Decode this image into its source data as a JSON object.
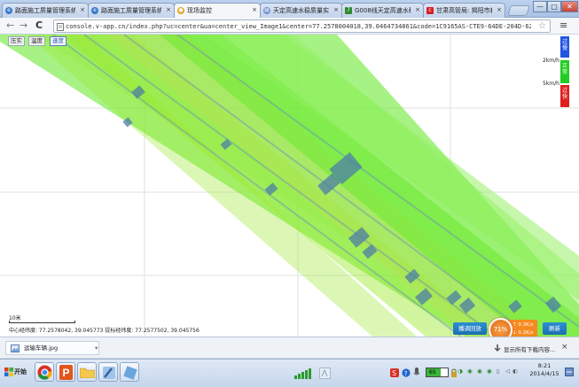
{
  "browser": {
    "tabs": [
      {
        "label": "路面施工质量管理系统",
        "icon_color": "#3a78c8",
        "active": false
      },
      {
        "label": "路面施工质量管理系统",
        "icon_color": "#3a78c8",
        "active": false
      },
      {
        "label": "现场监控",
        "icon_color": "#e8a11a",
        "active": true
      },
      {
        "label": "天定高速水稳质量实施工",
        "icon_color": "#6a8fc7",
        "active": false
      },
      {
        "label": "G008线天定高速水稳质量",
        "icon_color": "#2f8a2f",
        "active": false
      },
      {
        "label": "甘肃高管局: 揭阳市和丰",
        "icon_color": "#d42121",
        "active": false
      }
    ],
    "tab_close": "×",
    "window": {
      "minimize": "—",
      "maximize": "▢",
      "close": "✕"
    },
    "url": "console.v-app.cn/index.php?uc=center&ua=center_view_Image1&center=77.2578004018,39.0464734861&code=1C9165AS-CTE9-64DE-204D-6238676349B0&p",
    "nav": {
      "back": "←",
      "forward": "→",
      "reload": "C",
      "star": "☆",
      "menu": "≡"
    }
  },
  "map": {
    "mode_buttons": [
      "压实",
      "温度",
      "速度"
    ],
    "selected_mode": "速度",
    "legend": {
      "segments": [
        {
          "label": "过慢",
          "color": "#2255e0"
        },
        {
          "label": "正常",
          "color": "#22cc22"
        },
        {
          "label": "过快",
          "color": "#e02020"
        }
      ],
      "speed_labels": [
        "2km/h",
        "5km/h"
      ]
    },
    "scale_label": "10米",
    "coords_text": "中心经纬度: 77.2578042, 39.045773 捉标经纬度: 77.2577502, 39.045756",
    "review_button": "播调回放",
    "refresh_button": "刷新",
    "speed_value": "71%",
    "flow": {
      "up": "↑ 0.3K/s",
      "down": "↓ 0.2K/s"
    },
    "stripe_colors": [
      "#5fe81f",
      "#8ef05a",
      "#9be82a",
      "#b5e35a",
      "#4b7ea6",
      "#6a8fb5"
    ]
  },
  "downloads": {
    "file_name": "运输车辆.jpg",
    "show_all": "显示所有下载内容...",
    "close": "×"
  },
  "taskbar": {
    "start_label": "开始",
    "tray_clock_time": "8:21",
    "tray_clock_date": "2014/4/15",
    "battery_level": "65"
  }
}
